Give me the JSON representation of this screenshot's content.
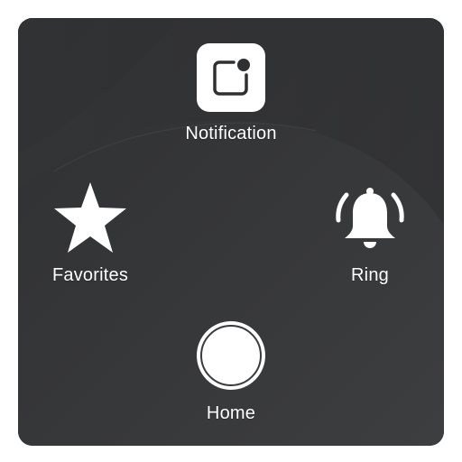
{
  "menu": {
    "items": [
      {
        "label": "Notification",
        "icon": "notification-icon"
      },
      {
        "label": "Favorites",
        "icon": "star-icon"
      },
      {
        "label": "Ring",
        "icon": "bell-icon"
      },
      {
        "label": "Home",
        "icon": "home-button-icon"
      }
    ]
  },
  "colors": {
    "panel": "#3a3b3d",
    "icon": "#ffffff",
    "label": "#ffffff"
  }
}
